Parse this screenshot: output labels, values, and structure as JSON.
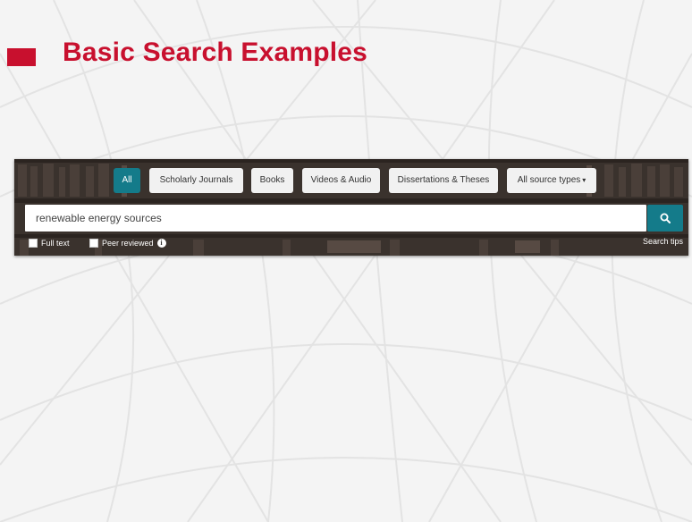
{
  "slide": {
    "title": "Basic Search Examples",
    "accent_color": "#c8102e"
  },
  "search": {
    "tabs": [
      {
        "label": "All",
        "active": true
      },
      {
        "label": "Scholarly Journals",
        "active": false
      },
      {
        "label": "Books",
        "active": false
      },
      {
        "label": "Videos & Audio",
        "active": false
      },
      {
        "label": "Dissertations & Theses",
        "active": false
      },
      {
        "label": "All source types",
        "active": false,
        "dropdown": true
      }
    ],
    "query": "renewable energy sources",
    "button_icon": "search-icon",
    "options": [
      {
        "label": "Full text",
        "checked": false
      },
      {
        "label": "Peer reviewed",
        "checked": false,
        "info_icon": "info-icon"
      }
    ],
    "tips_label": "Search tips",
    "accent_color": "#147b8a"
  }
}
